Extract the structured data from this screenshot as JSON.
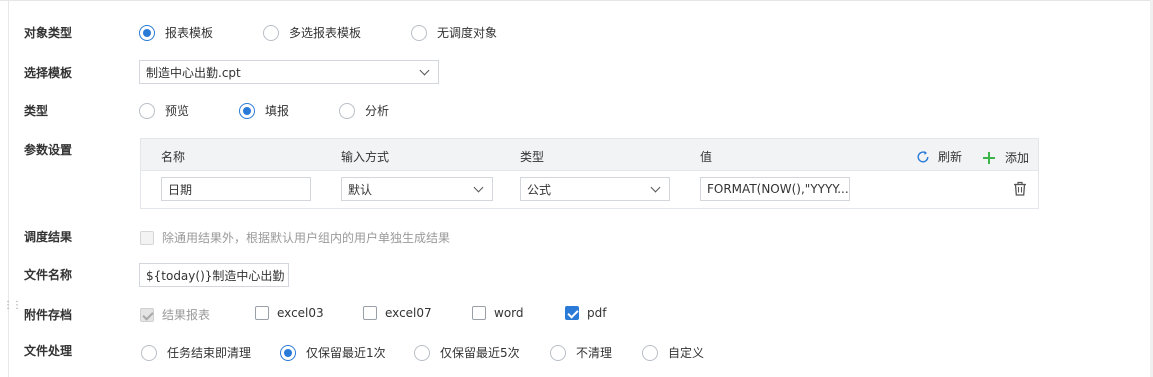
{
  "labels": {
    "object_type": "对象类型",
    "select_template": "选择模板",
    "type": "类型",
    "param_settings": "参数设置",
    "schedule_result": "调度结果",
    "file_name": "文件名称",
    "attachment_archive": "附件存档",
    "file_handling": "文件处理"
  },
  "object_type": {
    "options": [
      "报表模板",
      "多选报表模板",
      "无调度对象"
    ],
    "selected": "报表模板"
  },
  "template": {
    "value": "制造中心出勤.cpt"
  },
  "type": {
    "options": [
      "预览",
      "填报",
      "分析"
    ],
    "selected": "填报"
  },
  "params": {
    "headers": {
      "name": "名称",
      "input_method": "输入方式",
      "type": "类型",
      "value": "值"
    },
    "refresh_label": "刷新",
    "add_label": "添加",
    "rows": [
      {
        "name": "日期",
        "input_method": "默认",
        "type": "公式",
        "value": "FORMAT(NOW(),\"YYYY..."
      }
    ]
  },
  "schedule_result": {
    "checkbox_label": "除通用结果外，根据默认用户组内的用户单独生成结果",
    "checked": false,
    "disabled": true
  },
  "file_name": {
    "value": "${today()}制造中心出勤"
  },
  "attachments": {
    "items": [
      {
        "label": "结果报表",
        "checked": true,
        "disabled": true
      },
      {
        "label": "excel03",
        "checked": false,
        "disabled": false
      },
      {
        "label": "excel07",
        "checked": false,
        "disabled": false
      },
      {
        "label": "word",
        "checked": false,
        "disabled": false
      },
      {
        "label": "pdf",
        "checked": true,
        "disabled": false
      }
    ]
  },
  "file_handling": {
    "options": [
      "任务结束即清理",
      "仅保留最近1次",
      "仅保留最近5次",
      "不清理",
      "自定义"
    ],
    "selected": "仅保留最近1次"
  },
  "colors": {
    "accent": "#2a7bd8",
    "add_green": "#3cb44b",
    "header_bg": "#f1f3f5"
  },
  "icons": {
    "refresh": "refresh-icon",
    "add": "plus-icon",
    "delete": "trash-icon",
    "dropdown": "chevron-down-icon"
  }
}
